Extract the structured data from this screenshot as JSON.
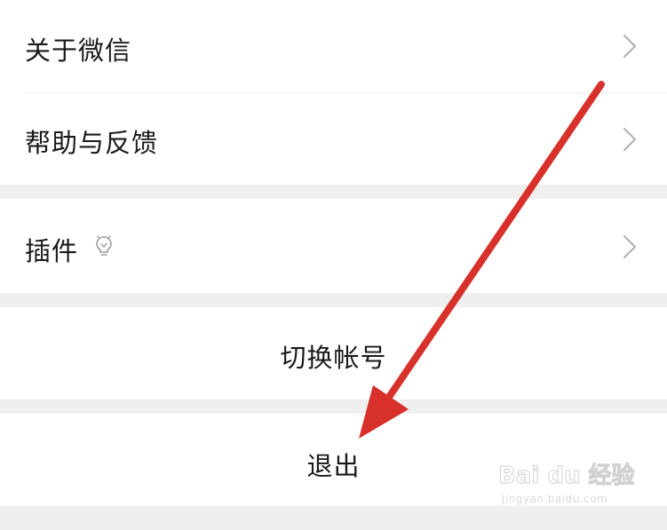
{
  "settings": {
    "about_label": "关于微信",
    "help_label": "帮助与反馈",
    "plugins_label": "插件",
    "switch_account_label": "切换帐号",
    "logout_label": "退出"
  },
  "icons": {
    "chevron": "chevron-right-icon",
    "plugin_badge": "lightbulb-icon",
    "annotation": "red-arrow-annotation"
  },
  "colors": {
    "background": "#efefef",
    "row_background": "#ffffff",
    "text": "#1a1a1a",
    "chevron": "#b2b2b2",
    "arrow": "#d8302a"
  },
  "watermark": {
    "brand": "Bai du 经验",
    "url": "jingyan.baidu.com"
  }
}
